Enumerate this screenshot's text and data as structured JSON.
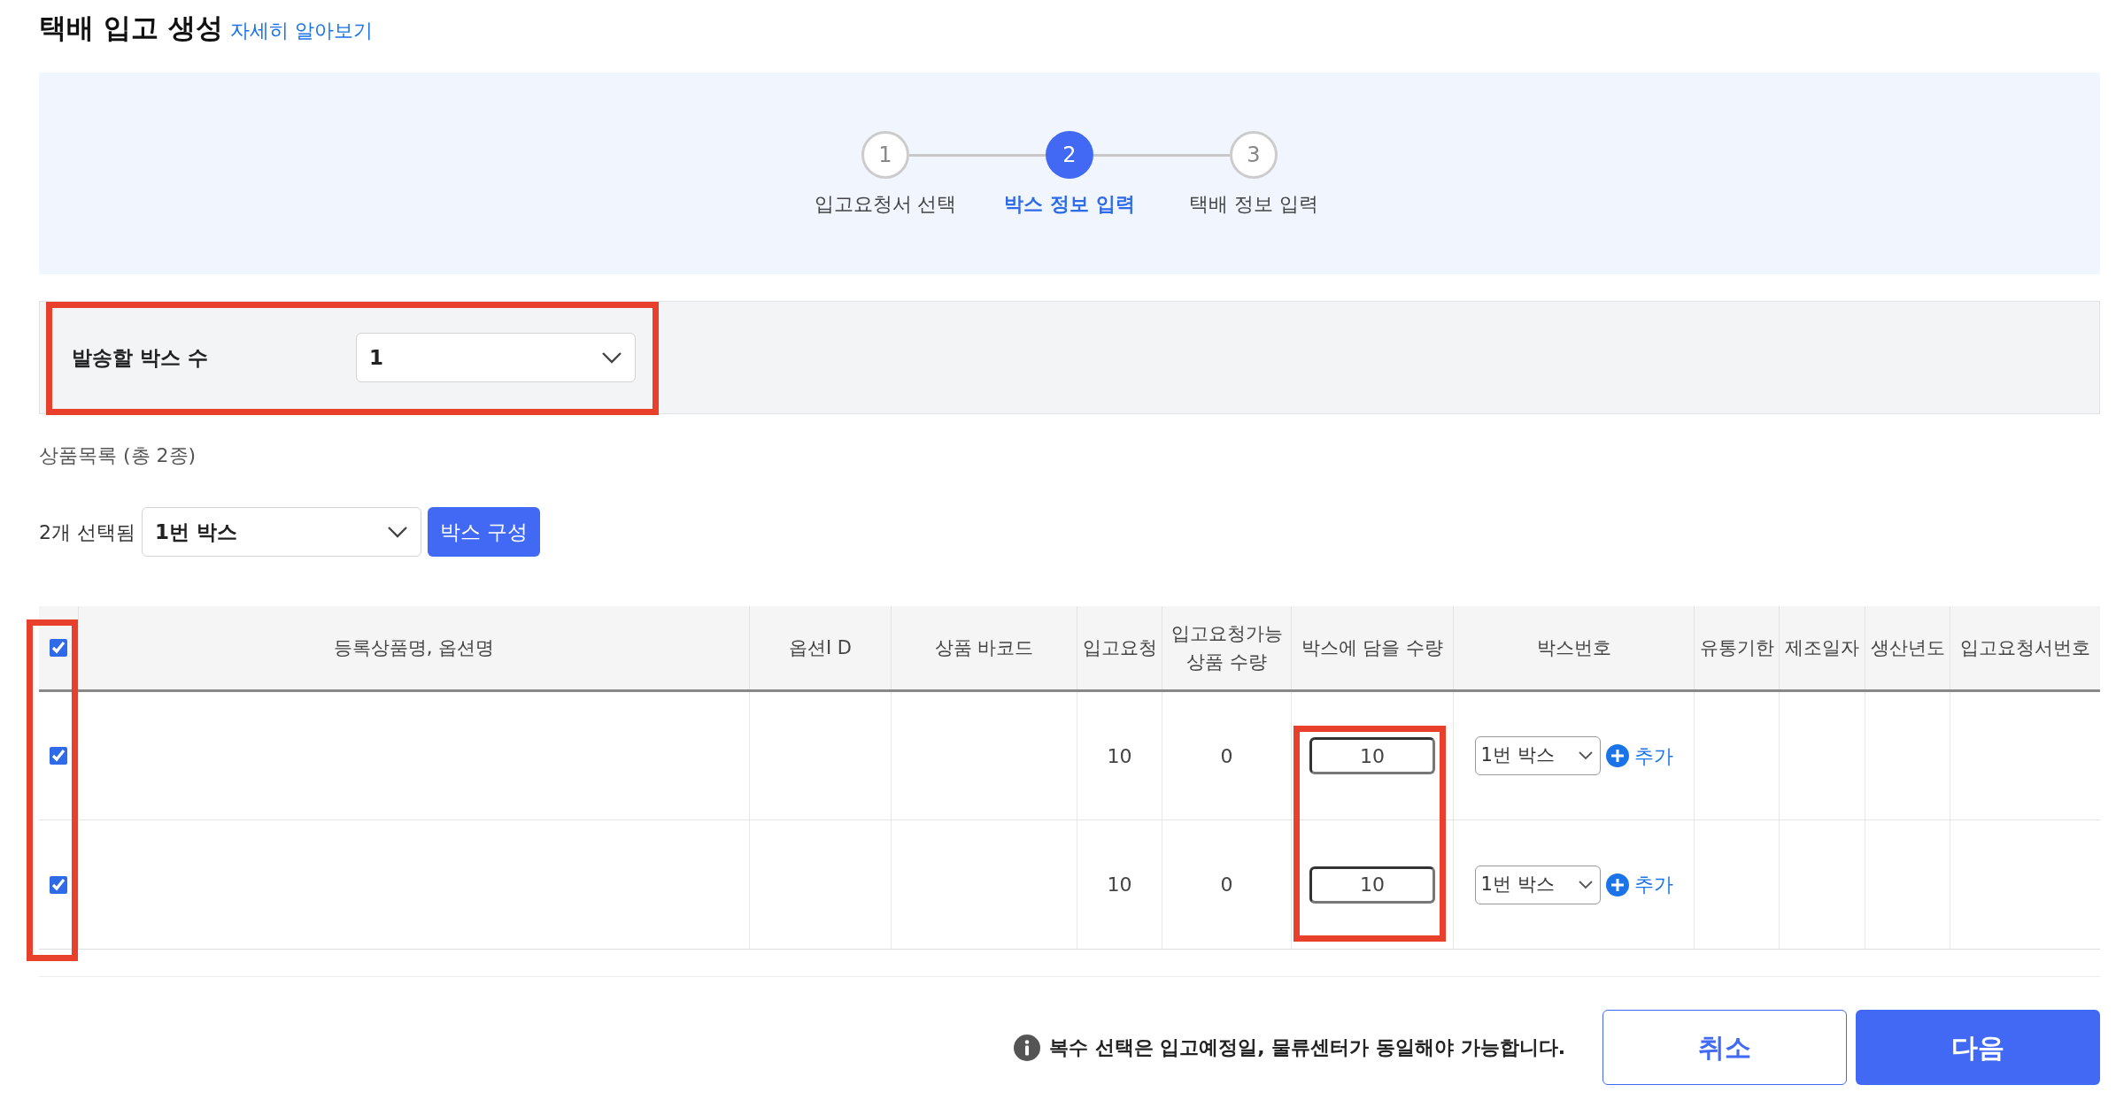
{
  "title": "택배 입고 생성",
  "help_link": "자세히 알아보기",
  "steps": [
    {
      "number": "1",
      "label": "입고요청서 선택",
      "selected": false
    },
    {
      "number": "2",
      "label": "박스 정보 입력",
      "selected": true
    },
    {
      "number": "3",
      "label": "택배 정보 입력",
      "selected": false
    }
  ],
  "box_count": {
    "label": "발송할 박스 수",
    "value": "1"
  },
  "product_list_label": "상품목록 (총 2종)",
  "selection": {
    "count_label": "2개 선택됨",
    "box_select": "1번 박스",
    "button": "박스 구성"
  },
  "table": {
    "select_all_checked": true,
    "columns": [
      "등록상품명, 옵션명",
      "옵션I D",
      "상품 바코드",
      "입고요청",
      "입고요청가능\n상품 수량",
      "박스에 담을 수량",
      "박스번호",
      "유통기한",
      "제조일자",
      "생산년도",
      "입고요청서번호"
    ],
    "rows": [
      {
        "checked": true,
        "request": "10",
        "available": "0",
        "quantity": "10",
        "box": "1번 박스",
        "add": "추가"
      },
      {
        "checked": true,
        "request": "10",
        "available": "0",
        "quantity": "10",
        "box": "1번 박스",
        "add": "추가"
      }
    ]
  },
  "footer": {
    "notice": "복수 선택은 입고예정일, 물류센터가 동일해야 가능합니다.",
    "cancel": "취소",
    "next": "다음"
  }
}
